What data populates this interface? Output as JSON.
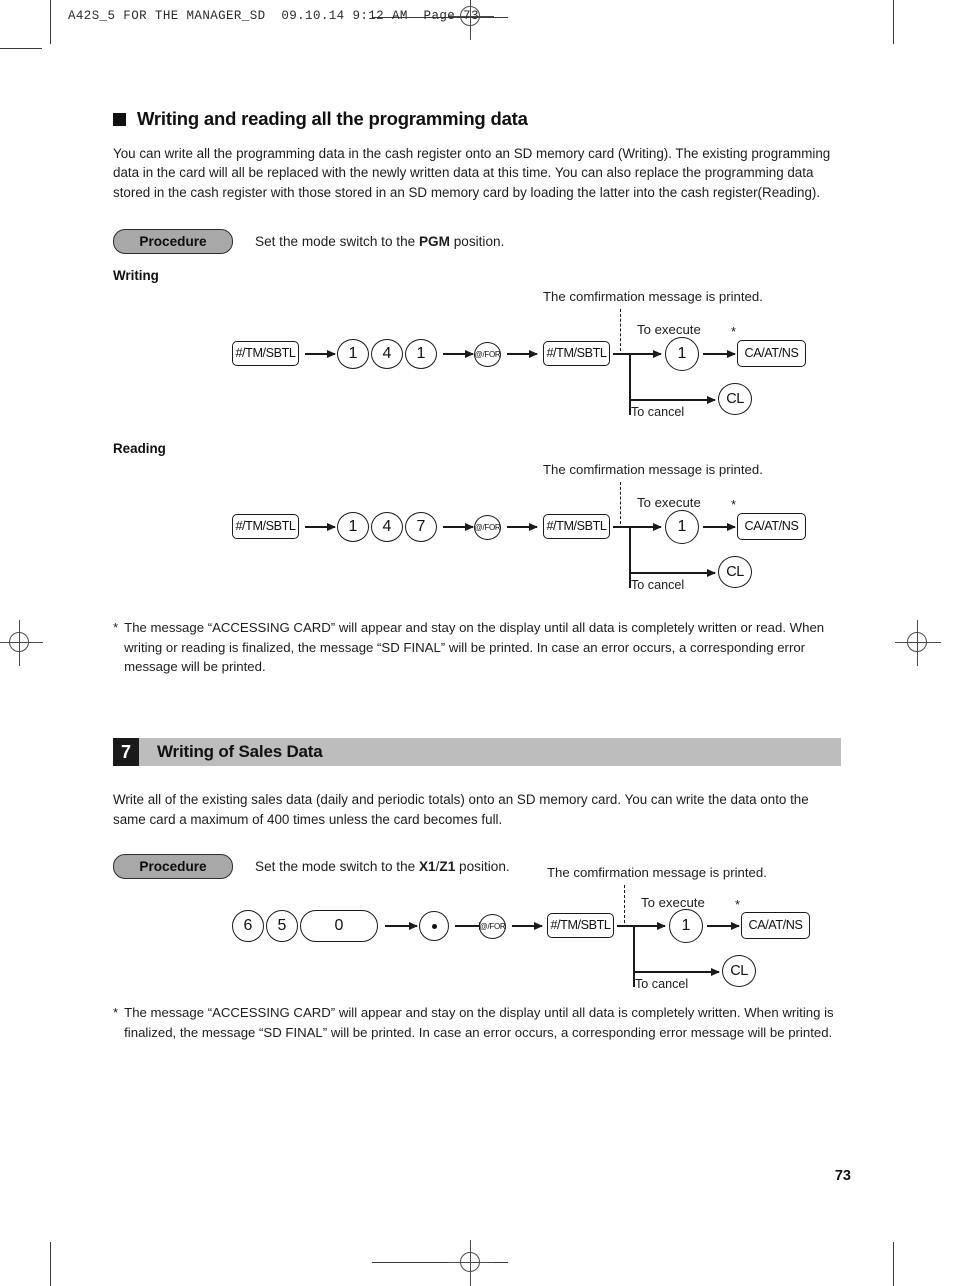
{
  "page": {
    "running_head": "A42S_5 FOR THE MANAGER_SD  09.10.14 9:12 AM  Page 73",
    "page_number": "73"
  },
  "section_writing_reading": {
    "heading": "Writing and reading all the programming data",
    "paragraph": "You can write all the programming data in the cash register onto an SD memory card (Writing). The existing programming data in the card will all be replaced with the newly written data at this time. You can also replace the programming data stored in the cash register with those stored in an SD memory card by loading the latter into the cash register(Reading).",
    "procedure": {
      "badge": "Procedure",
      "text_before": "Set the mode switch to the ",
      "mode": "PGM",
      "text_after": " position."
    },
    "writing_label": "Writing",
    "reading_label": "Reading",
    "note": {
      "marker": "*",
      "text": "The message “ACCESSING CARD” will appear and stay on the display until all data is completely written or read. When writing or reading is finalized, the message “SD FINAL” will be printed. In case an error occurs, a corresponding error message will be printed."
    }
  },
  "diagram_common": {
    "confirmation_caption": "The comfirmation message is printed.",
    "to_execute": "To execute",
    "to_cancel": "To cancel",
    "asterisk": "*",
    "key_tmsbtl": "#/TM/SBTL",
    "key_for": "@/FOR",
    "key_caatns": "CA/AT/NS",
    "key_cl": "CL",
    "key_one": "1"
  },
  "diagram_writing": {
    "keys": [
      "#/TM/SBTL",
      "1",
      "4",
      "1",
      "@/FOR",
      "#/TM/SBTL"
    ],
    "execute_key": "1",
    "execute_final_key": "CA/AT/NS",
    "cancel_key": "CL"
  },
  "diagram_reading": {
    "keys": [
      "#/TM/SBTL",
      "1",
      "4",
      "7",
      "@/FOR",
      "#/TM/SBTL"
    ],
    "execute_key": "1",
    "execute_final_key": "CA/AT/NS",
    "cancel_key": "CL"
  },
  "section_sales": {
    "number": "7",
    "title": "Writing of Sales Data",
    "paragraph": "Write all of the existing sales data (daily and periodic totals) onto an SD memory card. You can write the data onto the same card a maximum of 400 times unless the card becomes full.",
    "procedure": {
      "badge": "Procedure",
      "text_before": "Set the mode switch to the ",
      "mode_x1": "X1",
      "mode_sep": "/",
      "mode_z1": "Z1",
      "text_after": " position."
    },
    "note": {
      "marker": "*",
      "text": "The message “ACCESSING CARD” will appear and stay on the display until all data is completely written. When writing is finalized, the message “SD FINAL” will be printed. In case an error occurs, a corresponding error message will be printed."
    }
  },
  "diagram_sales": {
    "keys": [
      "6",
      "5",
      "0",
      "•",
      "@/FOR",
      "#/TM/SBTL"
    ],
    "execute_key": "1",
    "execute_final_key": "CA/AT/NS",
    "cancel_key": "CL"
  }
}
